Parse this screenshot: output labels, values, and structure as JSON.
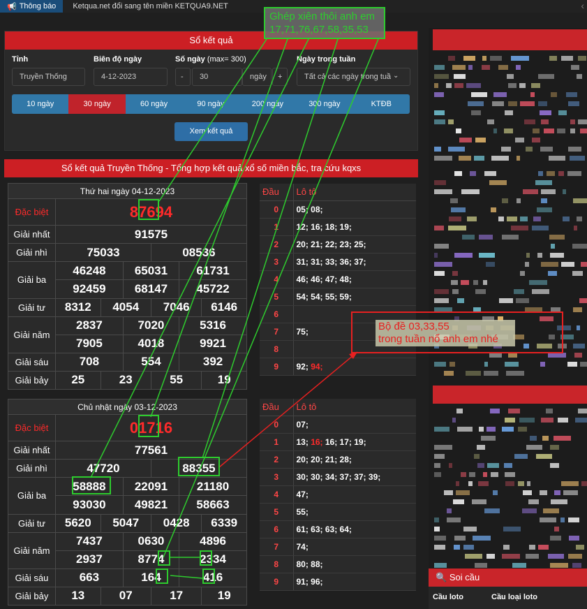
{
  "topbar": {
    "notice_label": "Thông báo",
    "announcement": "Ketqua.net đổi sang tên miền KETQUA9.NET"
  },
  "search": {
    "title": "Sổ kết quả",
    "province_label": "Tỉnh",
    "province_value": "Truyền Thống",
    "range_label": "Biên độ ngày",
    "range_value": "4-12-2023",
    "days_label": "Số ngày",
    "days_hint": "(max= 300)",
    "days_minus": "-",
    "days_value": "30",
    "days_unit": "ngày",
    "days_plus": "+",
    "weekday_label": "Ngày trong tuần",
    "weekday_value": "Tất cả các ngày trong tuần",
    "tabs": [
      "10 ngày",
      "30 ngày",
      "60 ngày",
      "90 ngày",
      "200 ngày",
      "300 ngày",
      "KTĐB"
    ],
    "active_tab": "30 ngày",
    "view_button": "Xem kết quả"
  },
  "section_title": "Sổ kết quả Truyền Thống - Tổng hợp kết quả xổ số miền bắc, tra cứu kqxs",
  "days": [
    {
      "date": "Thứ hai ngày 04-12-2023",
      "special_label": "Đặc biệt",
      "special": "87694",
      "first_label": "Giải nhất",
      "first": "91575",
      "second_label": "Giải nhì",
      "second": [
        "75033",
        "08536"
      ],
      "third_label": "Giải ba",
      "third": [
        "46248",
        "65031",
        "61731",
        "92459",
        "68147",
        "45722"
      ],
      "fourth_label": "Giải tư",
      "fourth": [
        "8312",
        "4054",
        "7046",
        "6146"
      ],
      "fifth_label": "Giải năm",
      "fifth": [
        "2837",
        "7020",
        "5316",
        "7905",
        "4018",
        "9921"
      ],
      "sixth_label": "Giải sáu",
      "sixth": [
        "708",
        "554",
        "392"
      ],
      "seventh_label": "Giải bảy",
      "seventh": [
        "25",
        "23",
        "55",
        "19"
      ],
      "loto_head": "Đầu",
      "loto_col": "Lô tô",
      "loto": [
        {
          "dau": "0",
          "lt": "05; 08;"
        },
        {
          "dau": "1",
          "lt": "12; 16; 18; 19;"
        },
        {
          "dau": "2",
          "lt": "20; 21; 22; 23; 25;"
        },
        {
          "dau": "3",
          "lt": "31; 31; 33; 36; 37;"
        },
        {
          "dau": "4",
          "lt": "46; 46; 47; 48;"
        },
        {
          "dau": "5",
          "lt": "54; 54; 55; 59;"
        },
        {
          "dau": "6",
          "lt": ""
        },
        {
          "dau": "7",
          "lt": "75;"
        },
        {
          "dau": "8",
          "lt": ""
        },
        {
          "dau": "9",
          "lt": "92;",
          "lt_red": "94;"
        }
      ]
    },
    {
      "date": "Chủ nhật ngày 03-12-2023",
      "special_label": "Đặc biệt",
      "special": "01716",
      "first_label": "Giải nhất",
      "first": "77561",
      "second_label": "Giải nhì",
      "second": [
        "47720",
        "88355"
      ],
      "third_label": "Giải ba",
      "third": [
        "58888",
        "22091",
        "21180",
        "93030",
        "49821",
        "58663"
      ],
      "fourth_label": "Giải tư",
      "fourth": [
        "5620",
        "5047",
        "0428",
        "6339"
      ],
      "fifth_label": "Giải năm",
      "fifth": [
        "7437",
        "0630",
        "4896",
        "2937",
        "8774",
        "2334"
      ],
      "sixth_label": "Giải sáu",
      "sixth": [
        "663",
        "164",
        "416"
      ],
      "seventh_label": "Giải bảy",
      "seventh": [
        "13",
        "07",
        "17",
        "19"
      ],
      "loto_head": "Đầu",
      "loto_col": "Lô tô",
      "loto": [
        {
          "dau": "0",
          "lt": "07;"
        },
        {
          "dau": "1",
          "lt_pre": "13; ",
          "lt_red": "16;",
          "lt": " 16; 17; 19;"
        },
        {
          "dau": "2",
          "lt": "20; 20; 21; 28;"
        },
        {
          "dau": "3",
          "lt": "30; 30; 34; 37; 37; 39;"
        },
        {
          "dau": "4",
          "lt": "47;"
        },
        {
          "dau": "5",
          "lt": "55;"
        },
        {
          "dau": "6",
          "lt": "61; 63; 63; 64;"
        },
        {
          "dau": "7",
          "lt": "74;"
        },
        {
          "dau": "8",
          "lt": "80; 88;"
        },
        {
          "dau": "9",
          "lt": "91; 96;"
        }
      ]
    }
  ],
  "annotations": {
    "green_line1": "Ghép xiên thôi anh em",
    "green_line2": "17,71,76,67,58,35,53",
    "red_line1": "Bộ đề 03,33,55",
    "red_line2": "trong tuần  nổ anh em  nhé"
  },
  "sidebar": {
    "soi_title": "Soi cầu",
    "col1": "Cầu loto",
    "col2": "Cầu loại loto"
  },
  "colors": {
    "red": "#cc1f24",
    "blue": "#3178a8",
    "green": "#2ecc2e"
  }
}
